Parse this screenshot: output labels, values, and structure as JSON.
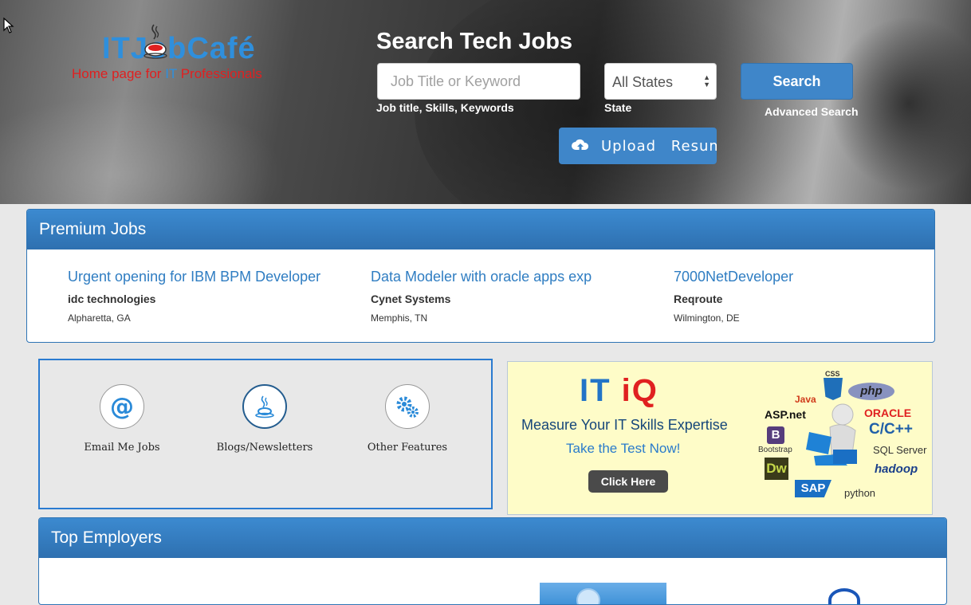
{
  "header": {
    "logo_text": "ITJobCafé",
    "logo_tagline_pre": "Home  page for ",
    "logo_tagline_it": "IT",
    "logo_tagline_post": " Professionals",
    "search_title": "Search Tech Jobs",
    "keyword_placeholder": "Job Title or Keyword",
    "keyword_help": "Job title, Skills, Keywords",
    "state_value": "All States",
    "state_help": "State",
    "search_label": "Search",
    "advanced_search": "Advanced Search",
    "upload_resume": "Upload Resume"
  },
  "premium": {
    "title": "Premium Jobs",
    "jobs": [
      {
        "title": "Urgent opening for IBM BPM Developer",
        "company": "idc technologies",
        "location": "Alpharetta, GA"
      },
      {
        "title": "Data Modeler with oracle apps exp",
        "company": "Cynet Systems",
        "location": "Memphis, TN"
      },
      {
        "title": "7000NetDeveloper",
        "company": "Reqroute",
        "location": "Wilmington, DE"
      }
    ]
  },
  "features": [
    {
      "label": "Email Me Jobs",
      "icon": "at-sign-icon"
    },
    {
      "label": "Blogs/Newsletters",
      "icon": "coffee-cup-icon"
    },
    {
      "label": "Other Features",
      "icon": "gears-icon"
    }
  ],
  "ad": {
    "brand_it": "IT",
    "brand_iq": "iQ",
    "headline": "Measure Your IT Skills Expertise",
    "subline": "Take the Test Now!",
    "button": "Click Here",
    "tech_labels": [
      "Java",
      "CSS",
      "php",
      "ASP.net",
      "ORACLE",
      "C/C++",
      "B",
      "Bootstrap",
      "SQL Server",
      "Dw",
      "hadoop",
      "SAP",
      "python"
    ]
  },
  "employers": {
    "title": "Top Employers"
  },
  "colors": {
    "primary_blue": "#3f86c9",
    "panel_blue": "#2e70b0",
    "link_blue": "#2f7dc2",
    "logo_red": "#e02020",
    "ad_bg": "#fefcc8"
  }
}
